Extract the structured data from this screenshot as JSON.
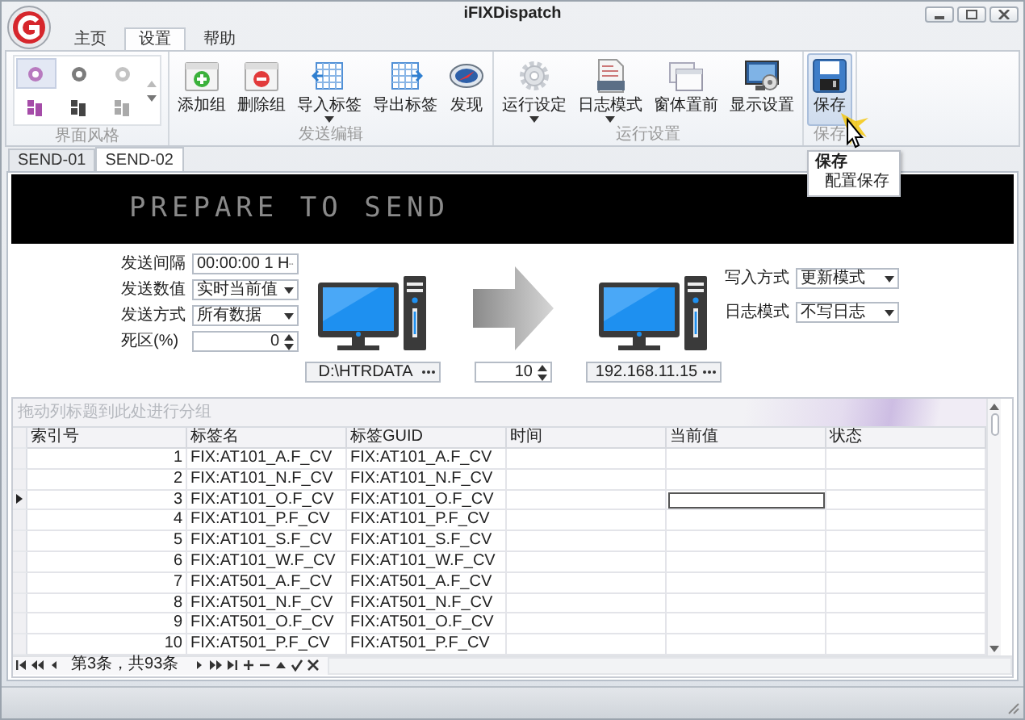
{
  "window": {
    "title": "iFIXDispatch"
  },
  "ribbon_tabs": [
    {
      "label": "主页",
      "selected": false
    },
    {
      "label": "设置",
      "selected": true
    },
    {
      "label": "帮助",
      "selected": false
    }
  ],
  "ribbon_groups": [
    {
      "label": "界面风格",
      "kind": "gallery",
      "items": [
        {
          "selected": true
        },
        {
          "selected": false
        },
        {
          "selected": false
        },
        {
          "selected": false
        },
        {
          "selected": false
        },
        {
          "selected": false
        }
      ]
    },
    {
      "label": "发送编辑",
      "kind": "buttons",
      "items": [
        {
          "label": "添加组",
          "kind": "add",
          "dropdown": false,
          "highlighted": false
        },
        {
          "label": "删除组",
          "kind": "delete",
          "dropdown": false,
          "highlighted": false
        },
        {
          "label": "导入标签",
          "kind": "import",
          "dropdown": true,
          "highlighted": false
        },
        {
          "label": "导出标签",
          "kind": "export",
          "dropdown": false,
          "highlighted": false
        },
        {
          "label": "发现",
          "kind": "discover",
          "dropdown": false,
          "highlighted": false
        }
      ]
    },
    {
      "label": "运行设置",
      "kind": "buttons",
      "items": [
        {
          "label": "运行设定",
          "kind": "settings",
          "dropdown": true,
          "highlighted": false
        },
        {
          "label": "日志模式",
          "kind": "log",
          "dropdown": true,
          "highlighted": false
        },
        {
          "label": "窗体置前",
          "kind": "window",
          "dropdown": false,
          "highlighted": false
        },
        {
          "label": "显示设置",
          "kind": "display",
          "dropdown": false,
          "highlighted": false
        }
      ]
    },
    {
      "label": "保存",
      "kind": "buttons",
      "items": [
        {
          "label": "保存",
          "kind": "save",
          "dropdown": false,
          "highlighted": true
        }
      ]
    }
  ],
  "tooltip": {
    "title": "保存",
    "description": "配置保存"
  },
  "document_tabs": [
    {
      "label": "SEND-01",
      "selected": false
    },
    {
      "label": "SEND-02",
      "selected": true
    }
  ],
  "banner": "PREPARE TO SEND",
  "send_settings": [
    {
      "label": "发送间隔",
      "value": "00:00:00 1 H",
      "kind": "ellipsis"
    },
    {
      "label": "发送数值",
      "value": "实时当前值",
      "kind": "dropdown"
    },
    {
      "label": "发送方式",
      "value": "所有数据",
      "kind": "dropdown"
    },
    {
      "label": "死区(%)",
      "value": "0",
      "kind": "spin"
    }
  ],
  "source_path": "D:\\HTRDATA",
  "send_count": "10",
  "target_address": "192.168.11.15",
  "write_settings": [
    {
      "label": "写入方式",
      "value": "更新模式",
      "kind": "dropdown"
    },
    {
      "label": "日志模式",
      "value": "不写日志",
      "kind": "dropdown"
    }
  ],
  "grid": {
    "group_panel_hint": "拖动列标题到此处进行分组",
    "columns": [
      "索引号",
      "标签名",
      "标签GUID",
      "时间",
      "当前值",
      "状态"
    ],
    "rows": [
      {
        "index": "1",
        "tag_name": "FIX:AT101_A.F_CV",
        "tag_guid": "FIX:AT101_A.F_CV",
        "selected": false
      },
      {
        "index": "2",
        "tag_name": "FIX:AT101_N.F_CV",
        "tag_guid": "FIX:AT101_N.F_CV",
        "selected": false
      },
      {
        "index": "3",
        "tag_name": "FIX:AT101_O.F_CV",
        "tag_guid": "FIX:AT101_O.F_CV",
        "selected": true
      },
      {
        "index": "4",
        "tag_name": "FIX:AT101_P.F_CV",
        "tag_guid": "FIX:AT101_P.F_CV",
        "selected": false
      },
      {
        "index": "5",
        "tag_name": "FIX:AT101_S.F_CV",
        "tag_guid": "FIX:AT101_S.F_CV",
        "selected": false
      },
      {
        "index": "6",
        "tag_name": "FIX:AT101_W.F_CV",
        "tag_guid": "FIX:AT101_W.F_CV",
        "selected": false
      },
      {
        "index": "7",
        "tag_name": "FIX:AT501_A.F_CV",
        "tag_guid": "FIX:AT501_A.F_CV",
        "selected": false
      },
      {
        "index": "8",
        "tag_name": "FIX:AT501_N.F_CV",
        "tag_guid": "FIX:AT501_N.F_CV",
        "selected": false
      },
      {
        "index": "9",
        "tag_name": "FIX:AT501_O.F_CV",
        "tag_guid": "FIX:AT501_O.F_CV",
        "selected": false
      },
      {
        "index": "10",
        "tag_name": "FIX:AT501_P.F_CV",
        "tag_guid": "FIX:AT501_P.F_CV",
        "selected": false
      }
    ],
    "navigator": "第3条，共93条"
  }
}
